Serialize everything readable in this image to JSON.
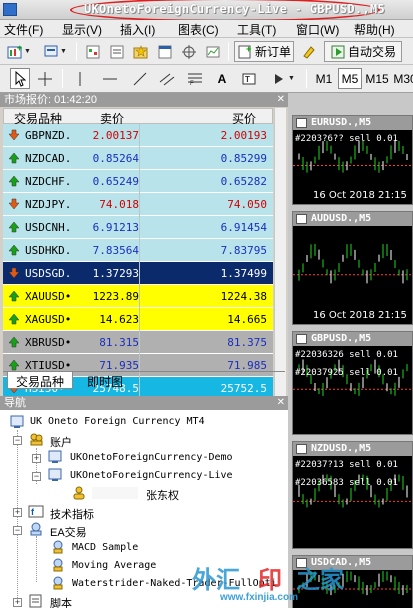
{
  "window": {
    "title": "UKOnetoForeignCurrency-Live - GBPUSD.,M5"
  },
  "menu": [
    "文件(F)",
    "显示(V)",
    "插入(I)",
    "图表(C)",
    "工具(T)",
    "窗口(W)",
    "帮助(H)"
  ],
  "toolbar": {
    "new_order": "新订单",
    "auto_trade": "自动交易"
  },
  "timeframes": [
    "M1",
    "M5",
    "M15",
    "M30"
  ],
  "market_watch": {
    "title": "市场报价: 01:42:20",
    "columns": {
      "symbol": "交易品种",
      "bid": "卖价",
      "ask": "买价"
    },
    "rows": [
      {
        "symbol": "GBPNZD.",
        "bid": "2.00137",
        "ask": "2.00193",
        "dir": "down",
        "bg": "#b9e3ea",
        "fg": "#d40000"
      },
      {
        "symbol": "NZDCAD.",
        "bid": "0.85264",
        "ask": "0.85299",
        "dir": "up",
        "bg": "#b9e3ea",
        "fg": "#1a2fbf"
      },
      {
        "symbol": "NZDCHF.",
        "bid": "0.65249",
        "ask": "0.65282",
        "dir": "up",
        "bg": "#b9e3ea",
        "fg": "#1a2fbf"
      },
      {
        "symbol": "NZDJPY.",
        "bid": "74.018",
        "ask": "74.050",
        "dir": "down",
        "bg": "#b9e3ea",
        "fg": "#d40000"
      },
      {
        "symbol": "USDCNH.",
        "bid": "6.91213",
        "ask": "6.91454",
        "dir": "up",
        "bg": "#b9e3ea",
        "fg": "#1a2fbf"
      },
      {
        "symbol": "USDHKD.",
        "bid": "7.83564",
        "ask": "7.83795",
        "dir": "up",
        "bg": "#b9e3ea",
        "fg": "#1a2fbf"
      },
      {
        "symbol": "USDSGD.",
        "bid": "1.37293",
        "ask": "1.37499",
        "dir": "down",
        "bg": "#0a2a6b",
        "fg": "#ffffff"
      },
      {
        "symbol": "XAUUSD•",
        "bid": "1223.89",
        "ask": "1224.38",
        "dir": "up",
        "bg": "#ffff00",
        "fg": "#000000"
      },
      {
        "symbol": "XAGUSD•",
        "bid": "14.623",
        "ask": "14.665",
        "dir": "up",
        "bg": "#ffff00",
        "fg": "#000000"
      },
      {
        "symbol": "XBRUSD•",
        "bid": "81.315",
        "ask": "81.375",
        "dir": "up",
        "bg": "#b0b0b0",
        "fg": "#1a2fbf"
      },
      {
        "symbol": "XTIUSD•",
        "bid": "71.935",
        "ask": "71.985",
        "dir": "up",
        "bg": "#b0b0b0",
        "fg": "#1a2fbf"
      },
      {
        "symbol": "HSI50•",
        "bid": "25748.5",
        "ask": "25752.5",
        "dir": "down",
        "bg": "#16b7e3",
        "fg": "#ffffff"
      }
    ],
    "tabs": [
      "交易品种",
      "即时图"
    ]
  },
  "navigator": {
    "title": "导航",
    "root": "UK Oneto Foreign Currency MT4",
    "accounts_label": "账户",
    "accounts": [
      "UKOnetoForeignCurrency-Demo",
      "UKOnetoForeignCurrency-Live"
    ],
    "user": "张东权",
    "indicators_label": "技术指标",
    "ea_label": "EA交易",
    "eas": [
      "MACD Sample",
      "Moving Average",
      "Waterstrider-Naked-Trader-FullOpti"
    ],
    "scripts_label": "脚本"
  },
  "charts": [
    {
      "title": "EURUSD.,M5",
      "date": "16 Oct 2018  21:15",
      "orders": [
        "#2203?6?? sell 0.01"
      ]
    },
    {
      "title": "AUDUSD.,M5",
      "date": "16 Oct 2018  21:15",
      "orders": []
    },
    {
      "title": "GBPUSD.,M5",
      "date": "",
      "orders": [
        "#22036326 sell 0.01",
        "#22037925 sell 0.01"
      ]
    },
    {
      "title": "NZDUSD.,M5",
      "date": "",
      "orders": [
        "#22037?13 sell 0.01",
        "#22036583 sell 0.01"
      ]
    },
    {
      "title": "USDCAD.,M5",
      "date": "",
      "orders": []
    }
  ],
  "watermark": {
    "text_a": "外汇",
    "text_b": "印",
    "text_c": "之家",
    "url": "www.fxinjia.com"
  }
}
